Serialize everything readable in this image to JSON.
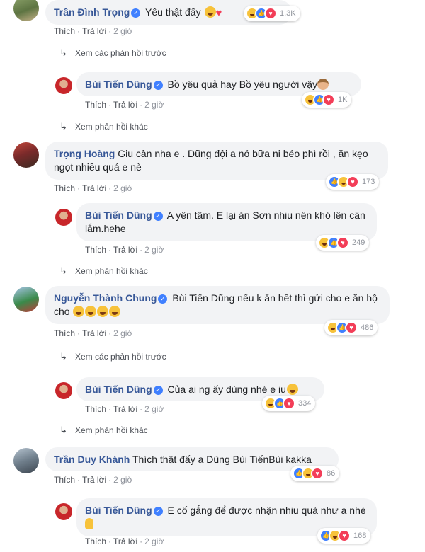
{
  "labels": {
    "like": "Thích",
    "reply": "Trả lời",
    "sep": "·"
  },
  "comments": [
    {
      "author": "Trần Đình Trọng",
      "text": "Yêu thật đấy",
      "time": "2 giờ",
      "reactions": [
        "haha",
        "like",
        "love"
      ],
      "count": "1,3K",
      "more_label": "Xem các phản hồi trước",
      "reply": {
        "author": "Bùi Tiến Dũng",
        "text": "Bồ yêu quả hay Bồ yêu người vậy",
        "time": "2 giờ",
        "reactions": [
          "haha",
          "like",
          "love"
        ],
        "count": "1K",
        "more_label": "Xem phản hồi khác"
      }
    },
    {
      "author": "Trọng Hoàng",
      "text": "Giu cân nha e . Dũng đội a nó bữa ni béo phì rồi , ăn kẹo ngọt nhiều quá e nè",
      "time": "2 giờ",
      "reactions": [
        "like",
        "haha",
        "love"
      ],
      "count": "173",
      "reply": {
        "author": "Bùi Tiến Dũng",
        "text": "A yên tâm. E lại ăn Sơn nhiu nên khó lên cân lắm.hehe",
        "time": "2 giờ",
        "reactions": [
          "haha",
          "like",
          "love"
        ],
        "count": "249",
        "more_label": "Xem phản hồi khác"
      }
    },
    {
      "author": "Nguyễn Thành Chung",
      "text": "Bùi Tiến Dũng nếu k ăn hết thì gửi cho e ăn hộ cho",
      "time": "2 giờ",
      "reactions": [
        "haha",
        "like",
        "love"
      ],
      "count": "486",
      "more_label": "Xem các phản hồi trước",
      "reply": {
        "author": "Bùi Tiến Dũng",
        "text": "Của ai ng ấy dùng nhé e iu",
        "time": "2 giờ",
        "reactions": [
          "haha",
          "like",
          "love"
        ],
        "count": "334",
        "more_label": "Xem phản hồi khác"
      }
    },
    {
      "author": "Trần Duy Khánh",
      "text": "Thích thật đấy a Dũng Bùi TiếnBùi kakka",
      "time": "2 giờ",
      "reactions": [
        "like",
        "haha",
        "love"
      ],
      "count": "86",
      "reply": {
        "author": "Bùi Tiến Dũng",
        "text": "E cố gắng để được nhận nhiu quà như a nhé",
        "time": "2 giờ",
        "reactions": [
          "like",
          "haha",
          "love"
        ],
        "count": "168"
      }
    }
  ]
}
